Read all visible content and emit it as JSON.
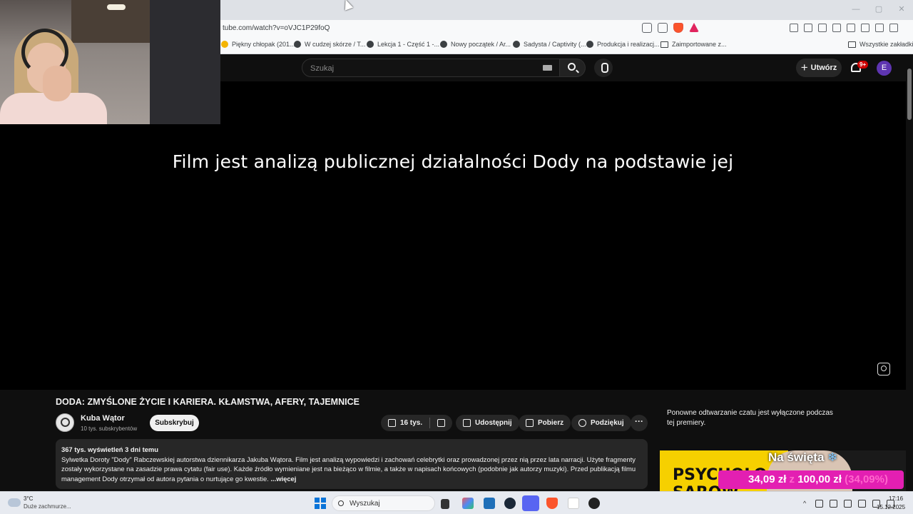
{
  "browser": {
    "url": "tube.com/watch?v=oVJC1P29foQ",
    "window_controls": [
      "—",
      "▢",
      "✕"
    ],
    "bookmarks": [
      "Piękny chłopak (201...",
      "W cudzej skórze / T...",
      "Lekcja 1 - Część 1 -...",
      "Nowy początek / Ar...",
      "Sadysta / Captivity (...",
      "Produkcja i realizacj...",
      "Zaimportowane z...",
      "Wszystkie zakładki"
    ]
  },
  "youtube": {
    "search_placeholder": "Szukaj",
    "create_label": "Utwórz",
    "notifications_badge": "9+",
    "avatar_letter": "E"
  },
  "player": {
    "subtitle": "Film jest analizą publicznej działalności Dody na podstawie jej"
  },
  "video": {
    "title": "DODA: ZMYŚLONE ŻYCIE I KARIERA. KŁAMSTWA, AFERY, TAJEMNICE",
    "channel_name": "Kuba Wątor",
    "channel_subs": "10 tys. subskrybentów",
    "subscribe_label": "Subskrybuj",
    "likes": "16 tys.",
    "share_label": "Udostępnij",
    "download_label": "Pobierz",
    "thanks_label": "Podziękuj",
    "more_label": "···",
    "views_date": "367 tys. wyświetleń  3 dni temu",
    "description": "Sylwetka Doroty \"Dody\" Rabczewskiej autorstwa dziennikarza Jakuba Wątora. Film jest analizą wypowiedzi i zachowań celebrytki oraz prowadzonej przez nią przez lata narracji. Użyte fragmenty zostały wykorzystane na zasadzie prawa cytatu (fair use). Każde źródło wymieniane jest na bieżąco w filmie, a także w napisach końcowych (podobnie jak autorzy muzyki). Przed publikacją filmu management Dody otrzymał od autora pytania o nurtujące go kwestie.",
    "description_more": "...więcej"
  },
  "chat": {
    "note": "Ponowne odtwarzanie czatu jest wyłączone podczas tej premiery."
  },
  "ad": {
    "brand_text": "PSYCHOLOG SAROW",
    "holiday_text": "Na święta",
    "snow": "❄",
    "price_new": "34,09 zł",
    "price_from": "z",
    "price_old": "100,00 zł",
    "discount": "(34,09%)"
  },
  "taskbar": {
    "temp": "3°C",
    "weather_desc": "Duże zachmurze...",
    "search_label": "Wyszukaj",
    "time": "17:16",
    "date": "15.12.2025",
    "tray_caret": "^"
  },
  "colors": {
    "yt_bg": "#0f0f0f",
    "pill_bg": "#272727",
    "ad_pink": "#e31fb2",
    "ad_yellow": "#f6d000",
    "taskbar": "#e7eaf0"
  }
}
